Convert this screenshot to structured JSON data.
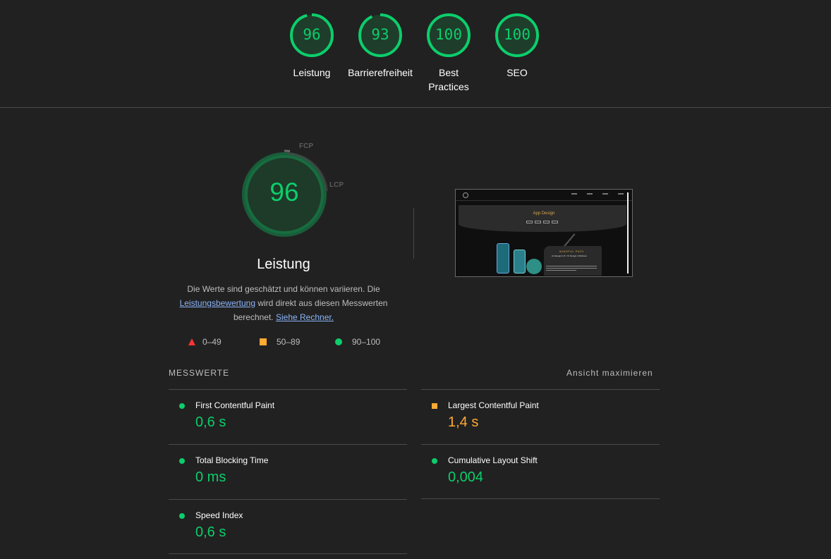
{
  "categories": [
    {
      "score": "96",
      "label": "Leistung"
    },
    {
      "score": "93",
      "label": "Barrierefreiheit"
    },
    {
      "score": "100",
      "label": "Best Practices"
    },
    {
      "score": "100",
      "label": "SEO"
    }
  ],
  "performance": {
    "score": "96",
    "title": "Leistung",
    "fcp_label": "FCP",
    "lcp_label": "LCP",
    "desc_part1": "Die Werte sind geschätzt und können variieren. Die ",
    "desc_link1": "Leistungsbewertung",
    "desc_part2": " wird direkt aus diesen Messwerten berechnet. ",
    "desc_link2": "Siehe Rechner."
  },
  "legend": [
    {
      "range": "0–49",
      "color": "#ff3333"
    },
    {
      "range": "50–89",
      "color": "#ffaa33"
    },
    {
      "range": "90–100",
      "color": "#0cce6b"
    }
  ],
  "thumbnail": {
    "hero_title": "App Design",
    "card_title": "MINDFUL PATH",
    "card_subtitle": "An Elegant UX / UI Design | Wellness"
  },
  "metrics": {
    "header": "MESSWERTE",
    "maximize": "Ansicht maximieren",
    "items": [
      {
        "label": "First Contentful Paint",
        "value": "0,6 s",
        "status": "good"
      },
      {
        "label": "Largest Contentful Paint",
        "value": "1,4 s",
        "status": "avg"
      },
      {
        "label": "Total Blocking Time",
        "value": "0 ms",
        "status": "good"
      },
      {
        "label": "Cumulative Layout Shift",
        "value": "0,004",
        "status": "good"
      },
      {
        "label": "Speed Index",
        "value": "0,6 s",
        "status": "good"
      }
    ]
  },
  "colors": {
    "pass": "#0cce6b",
    "average": "#ffaa33",
    "fail": "#ff3333",
    "background": "#212121"
  }
}
